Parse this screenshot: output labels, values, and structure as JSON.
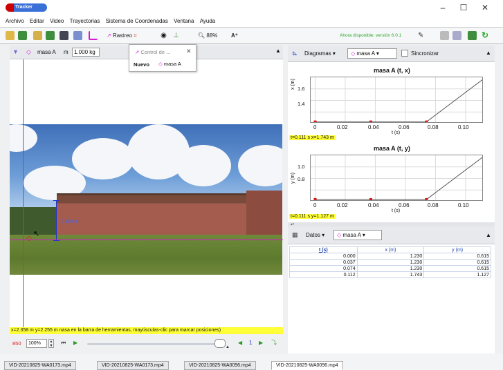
{
  "window": {
    "app_logo_text": "Tracker",
    "minimize": "–",
    "maximize": "☐",
    "close": "✕"
  },
  "menu": [
    "Archivo",
    "Editar",
    "Video",
    "Trayectorias",
    "Sistema de Coordenadas",
    "Ventana",
    "Ayuda"
  ],
  "toolbar": {
    "rastreo_label": "Rastreo",
    "zoom_label": "88%",
    "update_notice": "Ahora disponible: versión 6.0.1"
  },
  "track_bar": {
    "track_name": "masa A",
    "mass_label": "m",
    "mass_value": "1.000 kg"
  },
  "popup": {
    "title": "Control de ...",
    "nuevo_label": "Nuevo",
    "track_name": "masa A"
  },
  "video": {
    "distance_label": "0.800 m"
  },
  "status_bar": {
    "text": "x=2.358 m  y=2.255 m nasa en la barra de herramientas, mayúsculas-clic para marcar posiciones)"
  },
  "playback": {
    "frame": "850",
    "rate": "100%",
    "step_count": "1"
  },
  "plots_panel": {
    "view_label": "Diagramas",
    "track_name": "masa A",
    "sync_label": "Sincronizar"
  },
  "plot_x": {
    "title": "masa A (t, x)",
    "ylabel": "x (m)",
    "xlabel": "t (s)",
    "yticks": [
      "1.6",
      "1.4"
    ],
    "xticks": [
      "0",
      "0.02",
      "0.04",
      "0.06",
      "0.08",
      "0.10"
    ],
    "readout": "t=0.111 s  x=1.743 m"
  },
  "plot_y": {
    "title": "masa A (t, y)",
    "ylabel": "y (m)",
    "xlabel": "t (s)",
    "yticks": [
      "1.0",
      "0.8"
    ],
    "xticks": [
      "0",
      "0.02",
      "0.04",
      "0.06",
      "0.08",
      "0.10"
    ],
    "readout": "t=0.111 s  y=1.127 m"
  },
  "table_panel": {
    "view_label": "Datos",
    "track_name": "masa A",
    "columns": [
      "t (s)",
      "x (m)",
      "y (m)"
    ],
    "rows": [
      [
        "0.000",
        "1.230",
        "0.615"
      ],
      [
        "0.037",
        "1.230",
        "0.615"
      ],
      [
        "0.074",
        "1.230",
        "0.615"
      ],
      [
        "0.112",
        "1.743",
        "1.127"
      ]
    ]
  },
  "chart_data": [
    {
      "type": "line",
      "title": "masa A (t, x)",
      "xlabel": "t (s)",
      "ylabel": "x (m)",
      "x": [
        0.0,
        0.037,
        0.074,
        0.112
      ],
      "y": [
        1.23,
        1.23,
        1.23,
        1.743
      ],
      "xlim": [
        -0.003,
        0.112
      ],
      "ylim": [
        1.21,
        1.76
      ]
    },
    {
      "type": "line",
      "title": "masa A (t, y)",
      "xlabel": "t (s)",
      "ylabel": "y (m)",
      "x": [
        0.0,
        0.037,
        0.074,
        0.112
      ],
      "y": [
        0.615,
        0.615,
        0.615,
        1.127
      ],
      "xlim": [
        -0.003,
        0.112
      ],
      "ylim": [
        0.59,
        1.14
      ]
    }
  ],
  "file_tabs": [
    "VID-20210825-WA0173.mp4",
    "VID-20210825-WA0173.mp4",
    "VID-20210825-WA0096.mp4",
    "VID-20210825-WA0096.mp4"
  ],
  "colors": {
    "track_magenta": "#d51ad5",
    "readout_yellow": "#ffff38",
    "point_red": "#d81818",
    "axis_blue": "#2233cc"
  }
}
